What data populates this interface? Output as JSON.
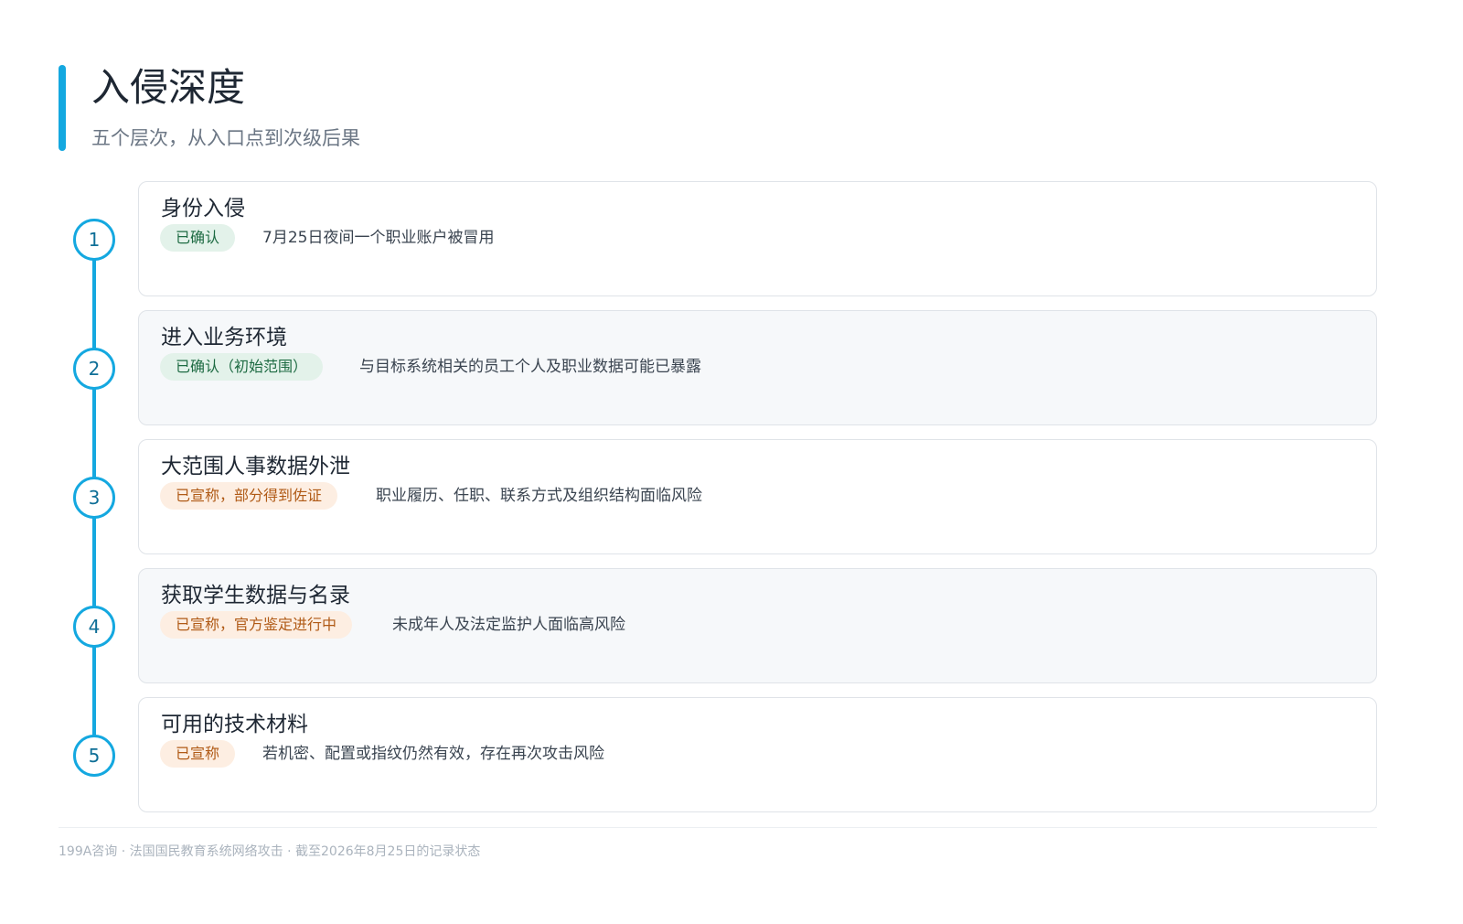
{
  "header": {
    "title": "入侵深度",
    "subtitle": "五个层次，从入口点到次级后果",
    "accent_color": "#14a8e0"
  },
  "steps": [
    {
      "number": "1",
      "title": "身份入侵",
      "status": "已确认",
      "status_type": "confirmed",
      "description": "7月25日夜间一个职业账户被冒用"
    },
    {
      "number": "2",
      "title": "进入业务环境",
      "status": "已确认（初始范围）",
      "status_type": "confirmed",
      "description": "与目标系统相关的员工个人及职业数据可能已暴露"
    },
    {
      "number": "3",
      "title": "大范围人事数据外泄",
      "status": "已宣称，部分得到佐证",
      "status_type": "claimed",
      "description": "职业履历、任职、联系方式及组织结构面临风险"
    },
    {
      "number": "4",
      "title": "获取学生数据与名录",
      "status": "已宣称，官方鉴定进行中",
      "status_type": "claimed",
      "description": "未成年人及法定监护人面临高风险"
    },
    {
      "number": "5",
      "title": "可用的技术材料",
      "status": "已宣称",
      "status_type": "claimed",
      "description": "若机密、配置或指纹仍然有效，存在再次攻击风险"
    }
  ],
  "status_colors": {
    "confirmed_bg": "#e3f2ea",
    "confirmed_text": "#1e6b43",
    "claimed_bg": "#fdeee2",
    "claimed_text": "#b05a16"
  },
  "footer": {
    "text": "199A咨询 · 法国国民教育系统网络攻击 · 截至2026年8月25日的记录状态"
  }
}
